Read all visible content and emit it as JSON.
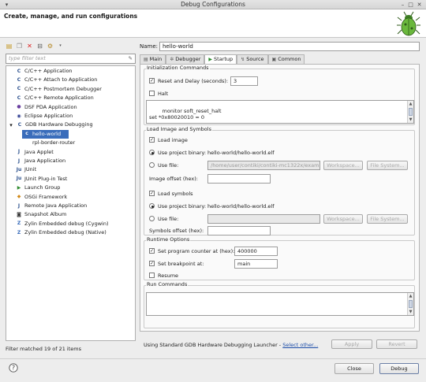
{
  "window": {
    "title": "Debug Configurations"
  },
  "header": {
    "title": "Create, manage, and run configurations"
  },
  "left": {
    "filter_placeholder": "type filter text",
    "tree": [
      {
        "label": "C/C++ Application",
        "icon": "c-app-icon",
        "indent": 1
      },
      {
        "label": "C/C++ Attach to Application",
        "icon": "c-attach-icon",
        "indent": 1
      },
      {
        "label": "C/C++ Postmortem Debugger",
        "icon": "c-postmortem-icon",
        "indent": 1
      },
      {
        "label": "C/C++ Remote Application",
        "icon": "c-remote-icon",
        "indent": 1
      },
      {
        "label": "DSF PDA Application",
        "icon": "pda-icon",
        "indent": 1
      },
      {
        "label": "Eclipse Application",
        "icon": "eclipse-icon",
        "indent": 1
      },
      {
        "label": "GDB Hardware Debugging",
        "icon": "gdb-icon",
        "indent": 0,
        "expanded": true
      },
      {
        "label": "hello-world",
        "icon": "c-file-icon",
        "indent": 2,
        "selected": true
      },
      {
        "label": "rpl-border-router",
        "icon": "c-file-icon",
        "indent": 2
      },
      {
        "label": "Java Applet",
        "icon": "java-applet-icon",
        "indent": 1
      },
      {
        "label": "Java Application",
        "icon": "java-app-icon",
        "indent": 1
      },
      {
        "label": "JUnit",
        "icon": "junit-icon",
        "indent": 1
      },
      {
        "label": "JUnit Plug-in Test",
        "icon": "junit-plugin-icon",
        "indent": 1
      },
      {
        "label": "Launch Group",
        "icon": "launch-group-icon",
        "indent": 1
      },
      {
        "label": "OSGi Framework",
        "icon": "osgi-icon",
        "indent": 1
      },
      {
        "label": "Remote Java Application",
        "icon": "remote-java-icon",
        "indent": 1
      },
      {
        "label": "Snapshot Album",
        "icon": "snapshot-icon",
        "indent": 1
      },
      {
        "label": "Zylin Embedded debug (Cygwin)",
        "icon": "zylin-icon",
        "indent": 1
      },
      {
        "label": "Zylin Embedded debug (Native)",
        "icon": "zylin-icon",
        "indent": 1
      }
    ],
    "filter_status": "Filter matched 19 of 21 items"
  },
  "right": {
    "name_label": "Name:",
    "name_value": "hello-world",
    "tabs": [
      {
        "label": "Main",
        "icon": "main-tab-icon"
      },
      {
        "label": "Debugger",
        "icon": "debugger-tab-icon"
      },
      {
        "label": "Startup",
        "icon": "startup-tab-icon",
        "active": true
      },
      {
        "label": "Source",
        "icon": "source-tab-icon"
      },
      {
        "label": "Common",
        "icon": "common-tab-icon"
      }
    ],
    "init": {
      "title": "Initialization Commands",
      "reset_label": "Reset and Delay (seconds):",
      "reset_checked": true,
      "reset_value": "3",
      "halt_label": "Halt",
      "halt_checked": false,
      "commands": "monitor soft_reset_halt\nset *0x80020010 = 0"
    },
    "load": {
      "title": "Load Image and Symbols",
      "load_image_label": "Load image",
      "load_image_checked": true,
      "use_project_binary_label": "Use project binary:",
      "image_binary": "hello-world/hello-world.elf",
      "use_file_label": "Use file:",
      "image_file": "/home/user/contiki/contiki-mc1322x/exam",
      "workspace_label": "Workspace...",
      "filesystem_label": "File System...",
      "image_offset_label": "Image offset (hex):",
      "image_offset_value": "",
      "load_symbols_label": "Load symbols",
      "load_symbols_checked": true,
      "symbols_binary": "hello-world/hello-world.elf",
      "symbols_file": "",
      "symbols_offset_label": "Symbols offset (hex):",
      "symbols_offset_value": ""
    },
    "runtime": {
      "title": "Runtime Options",
      "pc_label": "Set program counter at (hex):",
      "pc_checked": true,
      "pc_value": "400000",
      "bp_label": "Set breakpoint at:",
      "bp_checked": true,
      "bp_value": "main",
      "resume_label": "Resume",
      "resume_checked": false
    },
    "run_commands": {
      "title": "Run Commands",
      "value": ""
    },
    "launcher_text": "Using Standard GDB Hardware Debugging Launcher -",
    "launcher_link": "Select other...",
    "apply_label": "Apply",
    "revert_label": "Revert"
  },
  "footer": {
    "close_label": "Close",
    "debug_label": "Debug",
    "help_icon": "help-icon"
  }
}
